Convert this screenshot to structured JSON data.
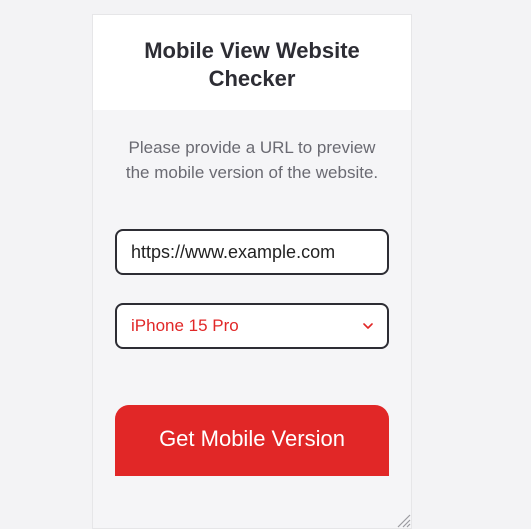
{
  "title": "Mobile View Website Checker",
  "instruction": "Please provide a URL to preview the mobile version of the website.",
  "url_input": {
    "value": "https://www.example.com",
    "placeholder": "https://www.example.com"
  },
  "device_select": {
    "selected": "iPhone 15 Pro"
  },
  "submit_label": "Get Mobile Version",
  "colors": {
    "accent": "#e12727",
    "text_dark": "#2d2d34",
    "text_muted": "#6a6a72"
  }
}
